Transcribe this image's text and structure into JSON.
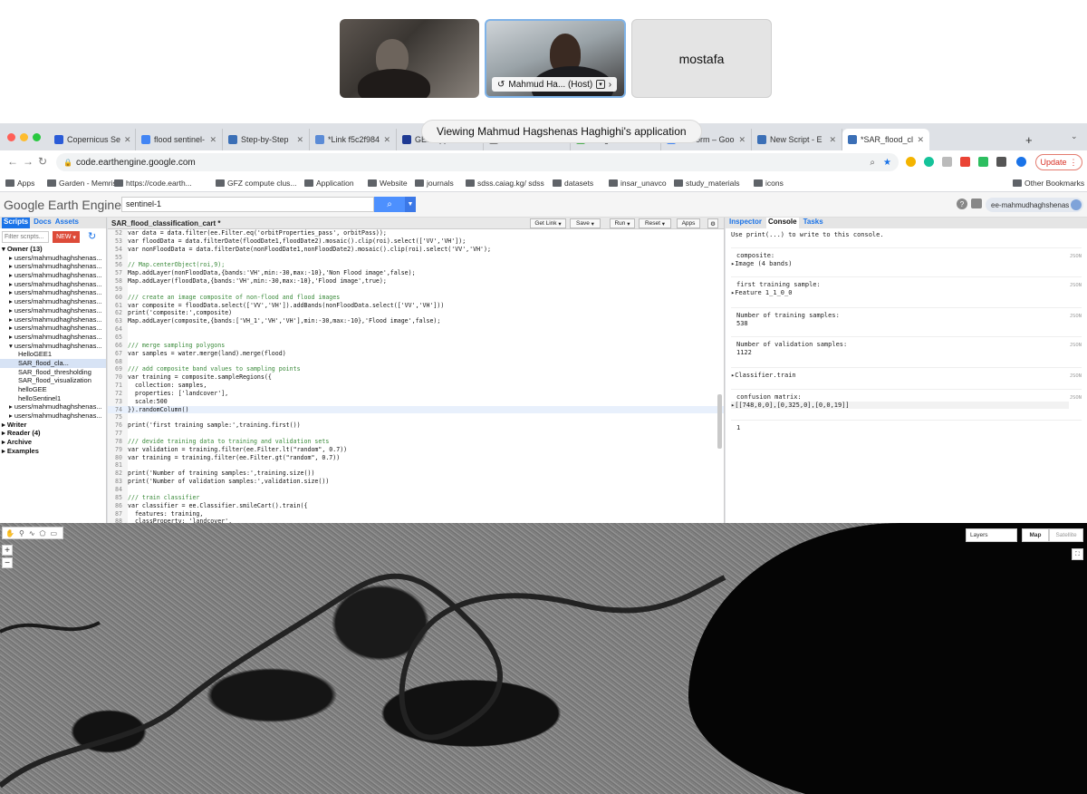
{
  "zoom": {
    "participants": [
      {
        "kind": "video"
      },
      {
        "kind": "video",
        "label": "Mahmud Ha... (Host)"
      },
      {
        "kind": "name",
        "label": "mostafa"
      }
    ],
    "banner": "Viewing Mahmud Hagshenas Haghighi's application"
  },
  "browser": {
    "tabs": [
      {
        "title": "Copernicus Se",
        "color": "#2a5bd7"
      },
      {
        "title": "flood sentinel-",
        "color": "#4285f4"
      },
      {
        "title": "Step-by-Step",
        "color": "#3b6fb6"
      },
      {
        "title": "*Link f5c2f984",
        "color": "#5b8bd6"
      },
      {
        "title": "GEE Apps",
        "color": "#1f3a93"
      },
      {
        "title": "New Tab",
        "color": "#777777"
      },
      {
        "title": "Google Earth E",
        "color": "#4caf50"
      },
      {
        "title": "Platform – Goo",
        "color": "#4285f4"
      },
      {
        "title": "New Script - E",
        "color": "#3b6fb6"
      },
      {
        "title": "*SAR_flood_cl",
        "color": "#3b6fb6"
      }
    ],
    "new_tab": "+",
    "url": "code.earthengine.google.com",
    "update_label": "Update",
    "bookmarks": [
      "Apps",
      "Garden - Memrise",
      "https://code.earth...",
      "GFZ compute clus...",
      "Application",
      "Website",
      "journals",
      "sdss.caiag.kg/ sdss",
      "datasets",
      "insar_unavco",
      "study_materials",
      "icons"
    ],
    "other_bookmarks": "Other Bookmarks"
  },
  "gee": {
    "logo": "Google Earth Engine",
    "search_value": "sentinel-1",
    "user": "ee-mahmudhaghshenas",
    "left_tabs": [
      "Scripts",
      "Docs",
      "Assets"
    ],
    "filter_placeholder": "Filter scripts...",
    "new_label": "NEW",
    "tree": [
      {
        "text": "▾ Owner (13)",
        "bold": true,
        "indent": 2
      },
      {
        "text": "▸ users/mahmudhaghshenas...",
        "indent": 10
      },
      {
        "text": "▸ users/mahmudhaghshenas...",
        "indent": 10
      },
      {
        "text": "▸ users/mahmudhaghshenas...",
        "indent": 10
      },
      {
        "text": "▸ users/mahmudhaghshenas...",
        "indent": 10
      },
      {
        "text": "▸ users/mahmudhaghshenas...",
        "indent": 10
      },
      {
        "text": "▸ users/mahmudhaghshenas...",
        "indent": 10
      },
      {
        "text": "▸ users/mahmudhaghshenas...",
        "indent": 10
      },
      {
        "text": "▸ users/mahmudhaghshenas...",
        "indent": 10
      },
      {
        "text": "▸ users/mahmudhaghshenas...",
        "indent": 10
      },
      {
        "text": "▸ users/mahmudhaghshenas...",
        "indent": 10
      },
      {
        "text": "▾ users/mahmudhaghshenas...",
        "indent": 10
      },
      {
        "text": "HelloGEE1",
        "indent": 20
      },
      {
        "text": "SAR_flood_cla...",
        "indent": 20,
        "selected": true
      },
      {
        "text": "SAR_flood_thresholding",
        "indent": 20
      },
      {
        "text": "SAR_flood_visualization",
        "indent": 20
      },
      {
        "text": "helloGEE",
        "indent": 20
      },
      {
        "text": "helloSentinel1",
        "indent": 20
      },
      {
        "text": "▸ users/mahmudhaghshenas...",
        "indent": 10
      },
      {
        "text": "▸ users/mahmudhaghshenas...",
        "indent": 10
      },
      {
        "text": "▸ Writer",
        "bold": true,
        "indent": 2
      },
      {
        "text": "▸ Reader (4)",
        "bold": true,
        "indent": 2
      },
      {
        "text": "▸ Archive",
        "bold": true,
        "indent": 2
      },
      {
        "text": "▸ Examples",
        "bold": true,
        "indent": 2
      }
    ],
    "editor": {
      "title": "SAR_flood_classification_cart *",
      "buttons": [
        "Get Link",
        "Save",
        "Run",
        "Reset",
        "Apps"
      ],
      "lines": [
        {
          "n": "52",
          "code": "var data = data.filter(ee.Filter.eq('orbitProperties_pass', orbitPass));"
        },
        {
          "n": "53",
          "code": "var floodData = data.filterDate(floodDate1,floodDate2).mosaic().clip(roi).select(['VV','VH']);"
        },
        {
          "n": "54",
          "code": "var nonFloodData = data.filterDate(nonFloodDate1,nonFloodDate2).mosaic().clip(roi).select('VV','VH');"
        },
        {
          "n": "55",
          "code": ""
        },
        {
          "n": "56",
          "code": "// Map.centerObject(roi,9);"
        },
        {
          "n": "57",
          "code": "Map.addLayer(nonFloodData,{bands:'VH',min:-30,max:-10},'Non Flood image',false);"
        },
        {
          "n": "58",
          "code": "Map.addLayer(floodData,{bands:'VH',min:-30,max:-10},'Flood image',true);"
        },
        {
          "n": "59",
          "code": ""
        },
        {
          "n": "60",
          "code": "/// create an image composite of non-flood and flood images"
        },
        {
          "n": "61",
          "code": "var composite = floodData.select(['VV','VH']).addBands(nonFloodData.select(['VV','VH']))"
        },
        {
          "n": "62",
          "code": "print('composite:',composite)"
        },
        {
          "n": "63",
          "code": "Map.addLayer(composite,{bands:['VH_1','VH','VH'],min:-30,max:-10},'Flood image',false);"
        },
        {
          "n": "64",
          "code": ""
        },
        {
          "n": "65",
          "code": ""
        },
        {
          "n": "66",
          "code": "/// merge sampling polygons"
        },
        {
          "n": "67",
          "code": "var samples = water.merge(land).merge(flood)"
        },
        {
          "n": "68",
          "code": ""
        },
        {
          "n": "69",
          "code": "/// add composite band values to sampling points"
        },
        {
          "n": "70",
          "code": "var training = composite.sampleRegions({"
        },
        {
          "n": "71",
          "code": "  collection: samples,"
        },
        {
          "n": "72",
          "code": "  properties: ['landcover'],"
        },
        {
          "n": "73",
          "code": "  scale:500"
        },
        {
          "n": "74",
          "code": "}).randomColumn()",
          "hl": true
        },
        {
          "n": "75",
          "code": ""
        },
        {
          "n": "76",
          "code": "print('first training sample:',training.first())"
        },
        {
          "n": "77",
          "code": ""
        },
        {
          "n": "78",
          "code": "/// devide training data to training and validation sets"
        },
        {
          "n": "79",
          "code": "var validation = training.filter(ee.Filter.lt(\"random\", 0.7))"
        },
        {
          "n": "80",
          "code": "var training = training.filter(ee.Filter.gt(\"random\", 0.7))"
        },
        {
          "n": "81",
          "code": ""
        },
        {
          "n": "82",
          "code": "print('Number of training samples:',training.size())"
        },
        {
          "n": "83",
          "code": "print('Number of validation samples:',validation.size())"
        },
        {
          "n": "84",
          "code": ""
        },
        {
          "n": "85",
          "code": "/// train classifier"
        },
        {
          "n": "86",
          "code": "var classifier = ee.Classifier.smileCart().train({"
        },
        {
          "n": "87",
          "code": "  features: training,"
        },
        {
          "n": "88",
          "code": "  classProperty: 'landcover',"
        },
        {
          "n": "89",
          "code": "  inputProperties: composite.bandNames()"
        },
        {
          "n": "90",
          "code": "})"
        },
        {
          "n": "91",
          "code": "print(classifier)"
        },
        {
          "n": "92",
          "code": ""
        },
        {
          "n": "93",
          "code": "/// run the classifier on the image composite"
        }
      ]
    },
    "right_tabs": [
      "Inspector",
      "Console",
      "Tasks"
    ],
    "console": {
      "hint": "Use print(...) to write to this console.",
      "json": "JSON",
      "entries": [
        {
          "label": "composite:",
          "value": "▸Image (4 bands)"
        },
        {
          "label": "first training sample:",
          "value": "▸Feature 1_1_0_0"
        },
        {
          "label": "Number of training samples:",
          "value": "538"
        },
        {
          "label": "Number of validation samples:",
          "value": "1122"
        },
        {
          "label": "▸Classifier.train",
          "value": ""
        },
        {
          "label": "confusion matrix:",
          "value": "▸[[748,0,0],[0,325,0],[0,0,19]]"
        },
        {
          "label": "1",
          "value": ""
        }
      ]
    },
    "map": {
      "layers_label": "Layers",
      "map_label": "Map",
      "satellite_label": "Satellite",
      "zoom_in": "+",
      "zoom_out": "−"
    }
  }
}
